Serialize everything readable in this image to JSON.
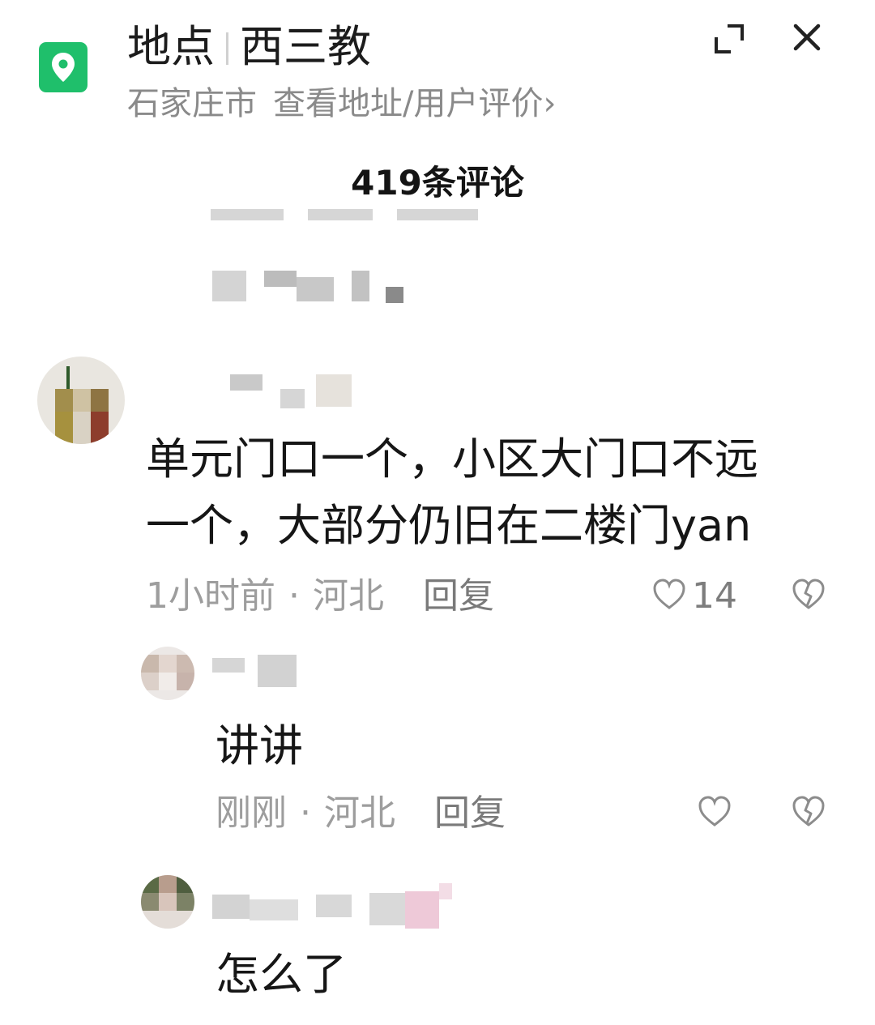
{
  "location": {
    "label": "地点",
    "name": "西三教",
    "city": "石家庄市",
    "link": "查看地址/用户评价",
    "link_chevron": "›",
    "icon": "map-pin-icon",
    "accent": "#1fbf6b"
  },
  "comments_header": {
    "count_text": "419条评论"
  },
  "comments": [
    {
      "text_line1": "单元门口一个，小区大门口不远",
      "text_line2": "一个，大部分仍旧在二楼门yan",
      "time": "1小时前",
      "region": "河北",
      "reply": "回复",
      "likes": "14"
    },
    {
      "text": "讲讲",
      "time": "刚刚",
      "region": "河北",
      "reply": "回复"
    },
    {
      "text": "怎么了"
    }
  ],
  "meta_separator": "·",
  "colors": {
    "text": "#161616",
    "muted": "#9d9d9d",
    "icon_gray": "#8c8c8c"
  }
}
